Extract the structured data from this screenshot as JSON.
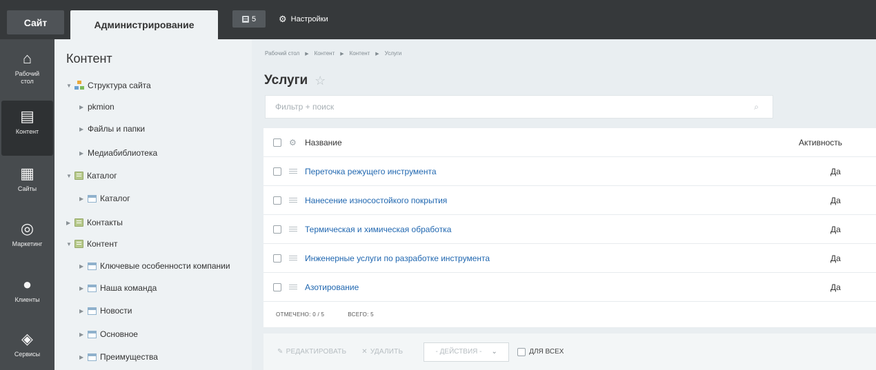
{
  "topbar": {
    "site_tab": "Сайт",
    "admin_tab": "Администрирование",
    "notifications_count": "5",
    "settings_label": "Настройки"
  },
  "left_menu": {
    "items": [
      {
        "label_line1": "Рабочий",
        "label_line2": "стол",
        "icon": "home-icon"
      },
      {
        "label_line1": "Контент",
        "label_line2": "",
        "icon": "document-icon"
      },
      {
        "label_line1": "Сайты",
        "label_line2": "",
        "icon": "calendar-icon"
      },
      {
        "label_line1": "Маркетинг",
        "label_line2": "",
        "icon": "target-icon"
      },
      {
        "label_line1": "Клиенты",
        "label_line2": "",
        "icon": "clients-icon"
      },
      {
        "label_line1": "Сервисы",
        "label_line2": "",
        "icon": "layers-icon"
      }
    ]
  },
  "tree": {
    "title": "Контент",
    "items": [
      {
        "label": "Структура сайта"
      },
      {
        "label": "pkmion"
      },
      {
        "label": "Файлы и папки"
      },
      {
        "label": "Медиабиблиотека"
      },
      {
        "label": "Каталог"
      },
      {
        "label": "Каталог"
      },
      {
        "label": "Контакты"
      },
      {
        "label": "Контент"
      },
      {
        "label": "Ключевые особенности компании"
      },
      {
        "label": "Наша команда"
      },
      {
        "label": "Новости"
      },
      {
        "label": "Основное"
      },
      {
        "label": "Преимущества"
      }
    ]
  },
  "breadcrumb": [
    "Рабочий стол",
    "Контент",
    "Контент",
    "Услуги"
  ],
  "page_title": "Услуги",
  "filter": {
    "placeholder": "Фильтр + поиск"
  },
  "grid": {
    "header": {
      "name": "Название",
      "active": "Активность"
    },
    "rows": [
      {
        "name": "Переточка режущего инструмента",
        "active": "Да"
      },
      {
        "name": "Нанесение износостойкого покрытия",
        "active": "Да"
      },
      {
        "name": "Термическая и химическая обработка",
        "active": "Да"
      },
      {
        "name": "Инженерные услуги по разработке инструмента",
        "active": "Да"
      },
      {
        "name": "Азотирование",
        "active": "Да"
      }
    ],
    "selected_label": "ОТМЕЧЕНО: 0 / 5",
    "total_label": "ВСЕГО: 5"
  },
  "footer": {
    "edit_label": "РЕДАКТИРОВАТЬ",
    "delete_label": "УДАЛИТЬ",
    "actions_label": "- ДЕЙСТВИЯ -",
    "for_all_label": "ДЛЯ ВСЕХ"
  }
}
